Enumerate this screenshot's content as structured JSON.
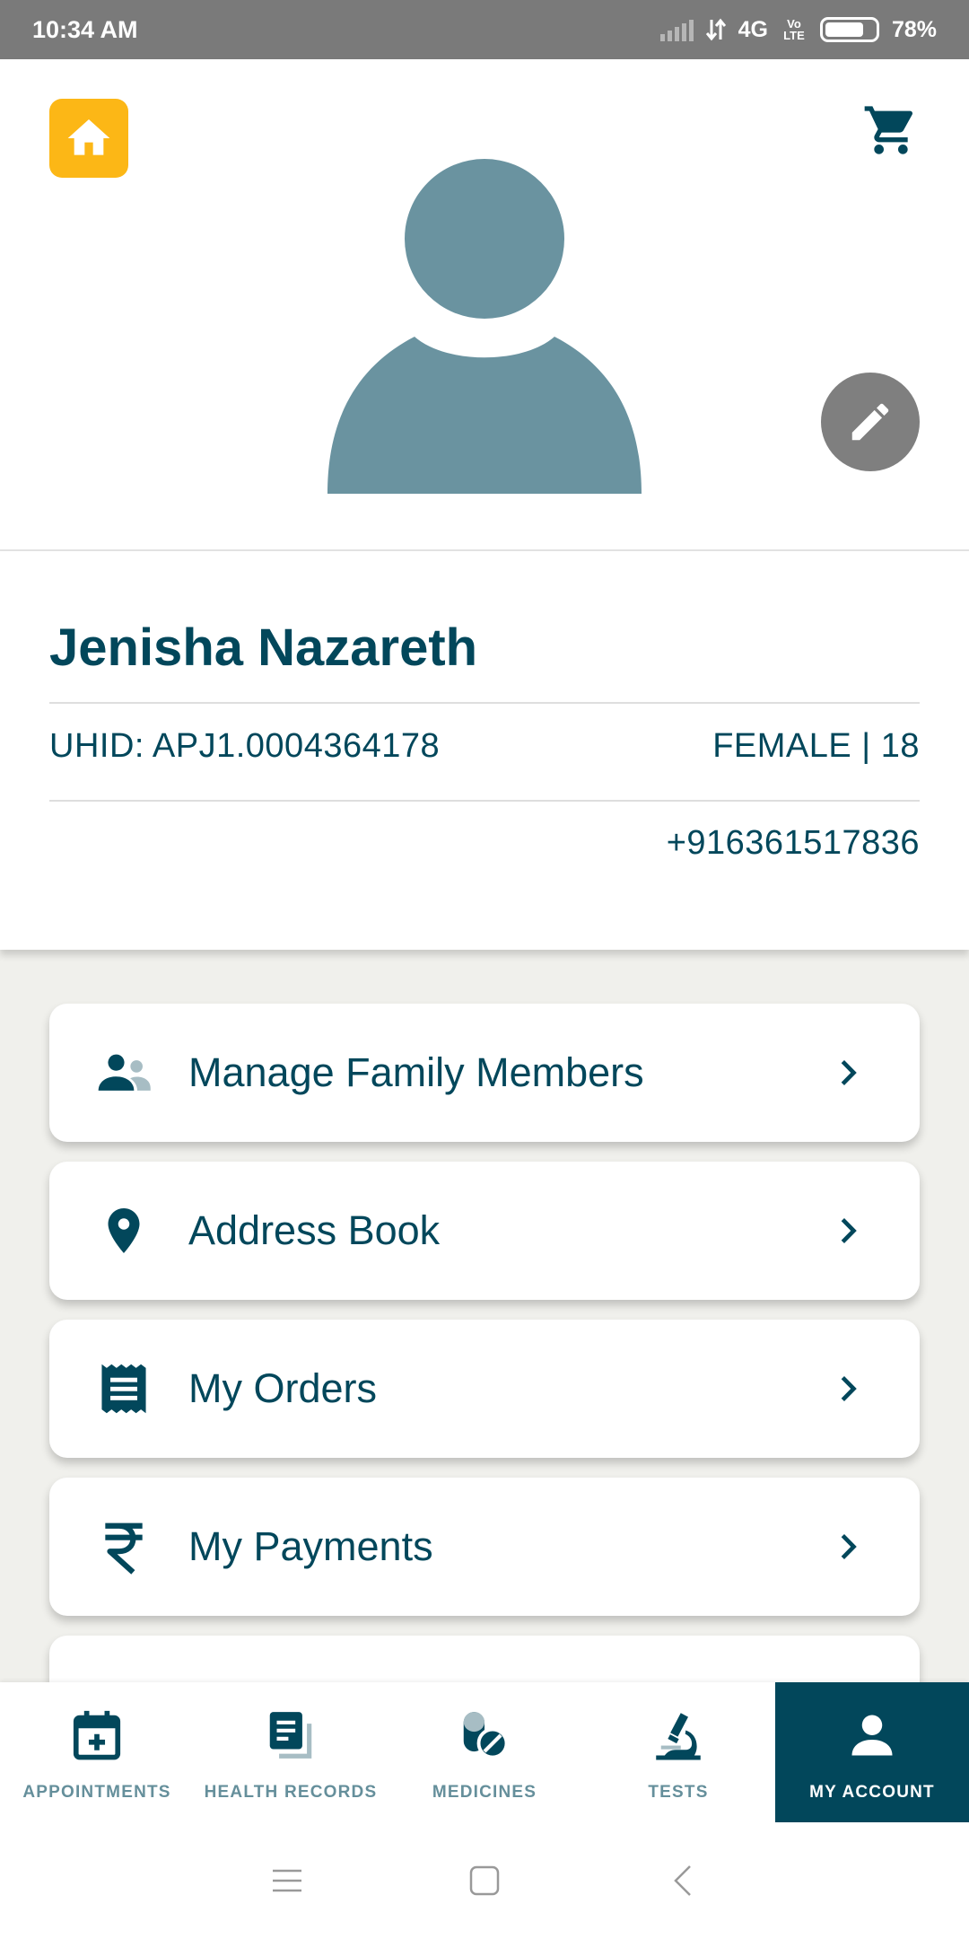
{
  "status_bar": {
    "time": "10:34 AM",
    "network": "4G",
    "volte": "Vo LTE",
    "battery": "78%",
    "battery_level": 0.78
  },
  "header": {
    "home_icon": "home-icon",
    "cart_icon": "cart-icon",
    "edit_icon": "pencil-icon",
    "accent_color": "#fcb716"
  },
  "profile": {
    "name": "Jenisha Nazareth",
    "uhid": "UHID: APJ1.0004364178",
    "gender_age": "FEMALE | 18",
    "phone": "+916361517836"
  },
  "menu": {
    "items": [
      {
        "label": "Manage Family Members",
        "icon": "family-icon"
      },
      {
        "label": "Address Book",
        "icon": "location-pin-icon"
      },
      {
        "label": "My Orders",
        "icon": "receipt-icon"
      },
      {
        "label": "My Payments",
        "icon": "rupee-icon"
      }
    ]
  },
  "bottom_nav": {
    "tabs": [
      {
        "label": "APPOINTMENTS",
        "icon": "calendar-plus-icon"
      },
      {
        "label": "HEALTH RECORDS",
        "icon": "records-icon"
      },
      {
        "label": "MEDICINES",
        "icon": "pills-icon"
      },
      {
        "label": "TESTS",
        "icon": "microscope-icon"
      },
      {
        "label": "MY ACCOUNT",
        "icon": "person-icon",
        "active": true
      }
    ]
  },
  "colors": {
    "primary": "#02475b",
    "background": "#f0f0ec",
    "avatar": "#6a93a0"
  }
}
